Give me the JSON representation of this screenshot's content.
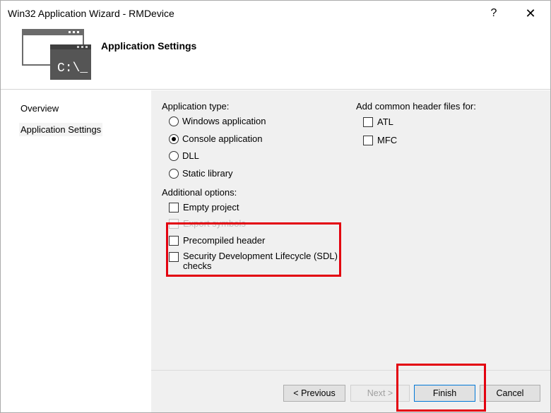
{
  "window": {
    "title": "Win32 Application Wizard - RMDevice",
    "help_glyph": "?",
    "close_glyph": "✕"
  },
  "header": {
    "title": "Application Settings",
    "icon_text": "C:\\_"
  },
  "nav": {
    "items": [
      {
        "label": "Overview"
      },
      {
        "label": "Application Settings",
        "selected": true
      }
    ]
  },
  "app_type": {
    "label": "Application type:",
    "options": [
      {
        "label": "Windows application",
        "checked": false
      },
      {
        "label": "Console application",
        "checked": true
      },
      {
        "label": "DLL",
        "checked": false
      },
      {
        "label": "Static library",
        "checked": false
      }
    ]
  },
  "additional": {
    "label": "Additional options:",
    "options": [
      {
        "label": "Empty project",
        "checked": false,
        "enabled": true
      },
      {
        "label": "Export symbols",
        "checked": false,
        "enabled": false
      },
      {
        "label": "Precompiled header",
        "checked": false,
        "enabled": true
      },
      {
        "label": "Security Development Lifecycle (SDL) checks",
        "checked": false,
        "enabled": true
      }
    ]
  },
  "headers": {
    "label": "Add common header files for:",
    "options": [
      {
        "label": "ATL",
        "checked": false
      },
      {
        "label": "MFC",
        "checked": false
      }
    ]
  },
  "buttons": {
    "previous": "< Previous",
    "next": "Next >",
    "finish": "Finish",
    "cancel": "Cancel"
  },
  "colors": {
    "highlight_box": "#e3000f",
    "icon_dark": "#555555"
  }
}
